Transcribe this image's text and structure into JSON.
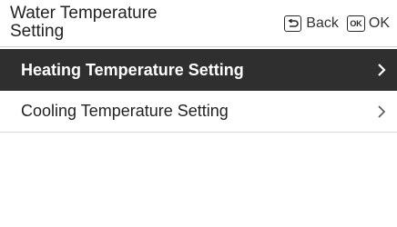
{
  "header": {
    "title_line1": "Water Temperature",
    "title_line2": "Setting",
    "back_label": "Back",
    "ok_label": "OK",
    "ok_key_text": "OK"
  },
  "menu": {
    "items": [
      {
        "label": "Heating Temperature Setting",
        "selected": true
      },
      {
        "label": "Cooling Temperature Setting",
        "selected": false
      }
    ]
  },
  "colors": {
    "selected_bg": "#2f2f2f",
    "selected_text": "#ffffff",
    "background": "#ffffff",
    "divider": "#d6d6d6"
  },
  "icons": [
    "back-key-icon",
    "ok-key-icon",
    "chevron-right-icon"
  ]
}
